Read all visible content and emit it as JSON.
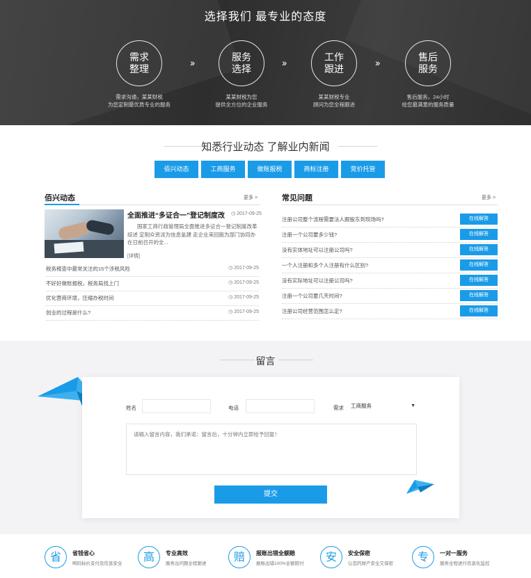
{
  "hero": {
    "title": "选择我们  最专业的态度",
    "steps": [
      {
        "name": "需求整理",
        "desc1": "需求沟通，某某财税",
        "desc2": "为您定制最优质专业的服务"
      },
      {
        "name": "服务选择",
        "desc1": "某某财税为您",
        "desc2": "提供全方位的企业服务"
      },
      {
        "name": "工作跟进",
        "desc1": "某某财税专业",
        "desc2": "顾问为您全程跟进"
      },
      {
        "name": "售后服务",
        "desc1": "售后服务，24小时",
        "desc2": "给您最满意的服务质量"
      }
    ],
    "arrow": "››"
  },
  "news_section": {
    "title": "知悉行业动态  了解业内新闻",
    "tabs": [
      "佰兴动态",
      "工商服务",
      "做账报税",
      "商标注册",
      "竞价托管"
    ]
  },
  "company_news": {
    "heading": "佰兴动态",
    "more": "更多 >",
    "featured": {
      "title": "全面推进“多证合一”登记制度改",
      "date": "2017-09-25",
      "text": "国家工商行政管理局全面推进多证合一登记制度改革综述 定制众资派为信息氪建 走企业来回跑为部门协同办在日前召开的全...",
      "more": "[详情]"
    },
    "items": [
      {
        "title": "税务稽查中最常关注的15个涉税风险",
        "date": "2017-09-25"
      },
      {
        "title": "不好好做账报税，税务局找上门",
        "date": "2017-09-25"
      },
      {
        "title": "优化营商环境，压缩办税时间",
        "date": "2017-09-25"
      },
      {
        "title": "创业的过程是什么?",
        "date": "2017-09-25"
      }
    ]
  },
  "faq": {
    "heading": "常见问题",
    "more": "更多 >",
    "button_label": "在线解答",
    "items": [
      "注册公司整个流程需要法人跟股东到现场吗?",
      "注册一个公司要多少钱?",
      "没有实体地址可以注册公司吗?",
      "一个人注册和多个人注册有什么区别?",
      "没有实际地址可以注册公司吗?",
      "注册一个公司要几天时间?",
      "注册公司经营范围怎么定?"
    ]
  },
  "message": {
    "title": "留言",
    "name_label": "姓名",
    "phone_label": "电话",
    "need_label": "需求",
    "need_value": "工商服务",
    "textarea_placeholder": "请输入留言内容，我们承诺：留言后，十分钟内立即给予回复！",
    "submit": "提交"
  },
  "features": [
    {
      "icon_char": "省",
      "title": "省钱省心",
      "sub": "明码标价支付及信息安全"
    },
    {
      "icon_char": "高",
      "title": "专业高效",
      "sub": "服务出问题全程跟进"
    },
    {
      "icon_char": "赔",
      "title": "报账出错全额赔",
      "sub": "报账出错100%全额赔付"
    },
    {
      "icon_char": "安",
      "title": "安全保密",
      "sub": "让您的财产安全又保密"
    },
    {
      "icon_char": "专",
      "title": "一对一服务",
      "sub": "服务全程进行信息化监控"
    }
  ],
  "colors": {
    "accent": "#1a9be8",
    "hero_bg": "#333333",
    "message_bg": "#f3f3f5"
  }
}
